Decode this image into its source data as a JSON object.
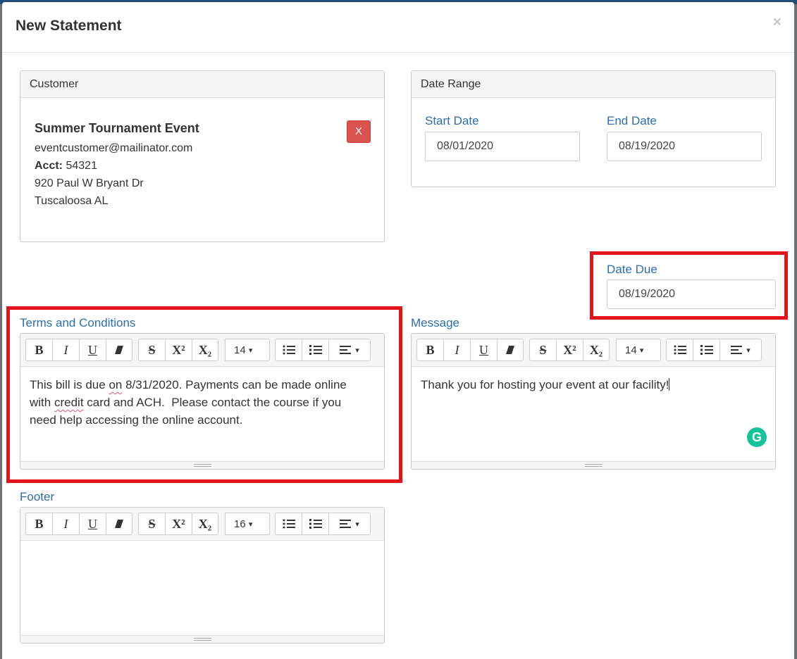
{
  "modal": {
    "title": "New Statement",
    "close": "×"
  },
  "customer": {
    "heading": "Customer",
    "name": "Summer Tournament Event",
    "email": "eventcustomer@mailinator.com",
    "acct_label": "Acct:",
    "acct_value": "54321",
    "address1": "920 Paul W Bryant Dr",
    "address2": "Tuscaloosa AL",
    "remove_label": "X"
  },
  "date_range": {
    "heading": "Date Range",
    "start_label": "Start Date",
    "start_value": "08/01/2020",
    "end_label": "End Date",
    "end_value": "08/19/2020"
  },
  "date_due": {
    "label": "Date Due",
    "value": "08/19/2020"
  },
  "toolbar": {
    "bold": "B",
    "italic": "I",
    "underline": "U",
    "strike": "S",
    "superscript": "X²",
    "subscript": "X₂",
    "caret": "▾"
  },
  "terms": {
    "label": "Terms and Conditions",
    "font_size": "14",
    "text_1": "This bill is due ",
    "text_on": "on",
    "text_2": " 8/31/2020. Payments can be made online",
    "text_3": "with ",
    "text_credit": "credit",
    "text_4": " card and ACH.  Please contact the course if you",
    "text_5": "need help accessing the online account."
  },
  "message": {
    "label": "Message",
    "font_size": "14",
    "text": "Thank you for hosting your event at our facility!"
  },
  "footer": {
    "label": "Footer",
    "font_size": "16",
    "text": ""
  },
  "colors": {
    "highlight": "#e3141b",
    "label_blue": "#2a6eb0",
    "danger": "#d9534f",
    "grammarly": "#15c39a"
  }
}
